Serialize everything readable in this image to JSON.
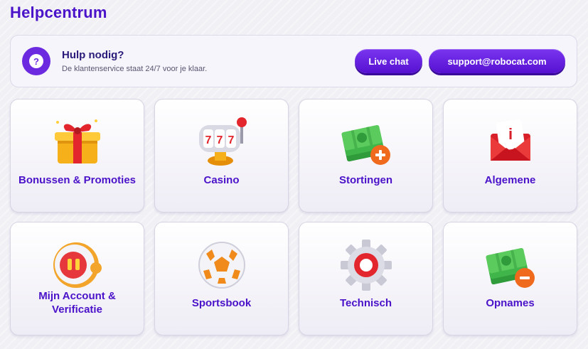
{
  "page_title": "Helpcentrum",
  "help": {
    "icon": "question-icon",
    "icon_glyph": "?",
    "title": "Hulp nodig?",
    "subtitle": "De klantenservice staat 24/7 voor je klaar.",
    "live_chat_label": "Live chat",
    "email_label": "support@robocat.com"
  },
  "categories": [
    {
      "label": "Bonussen & Promoties",
      "icon": "gift-icon"
    },
    {
      "label": "Casino",
      "icon": "slot-machine-icon"
    },
    {
      "label": "Stortingen",
      "icon": "cash-plus-icon"
    },
    {
      "label": "Algemene",
      "icon": "info-envelope-icon"
    },
    {
      "label": "Mijn Account & Verificatie",
      "icon": "robot-avatar-icon"
    },
    {
      "label": "Sportsbook",
      "icon": "soccer-ball-icon"
    },
    {
      "label": "Technisch",
      "icon": "gear-icon"
    },
    {
      "label": "Opnames",
      "icon": "cash-minus-icon"
    }
  ],
  "colors": {
    "accent": "#4a12c9",
    "button": "#6b2ae0",
    "background": "#f1f0f5"
  }
}
